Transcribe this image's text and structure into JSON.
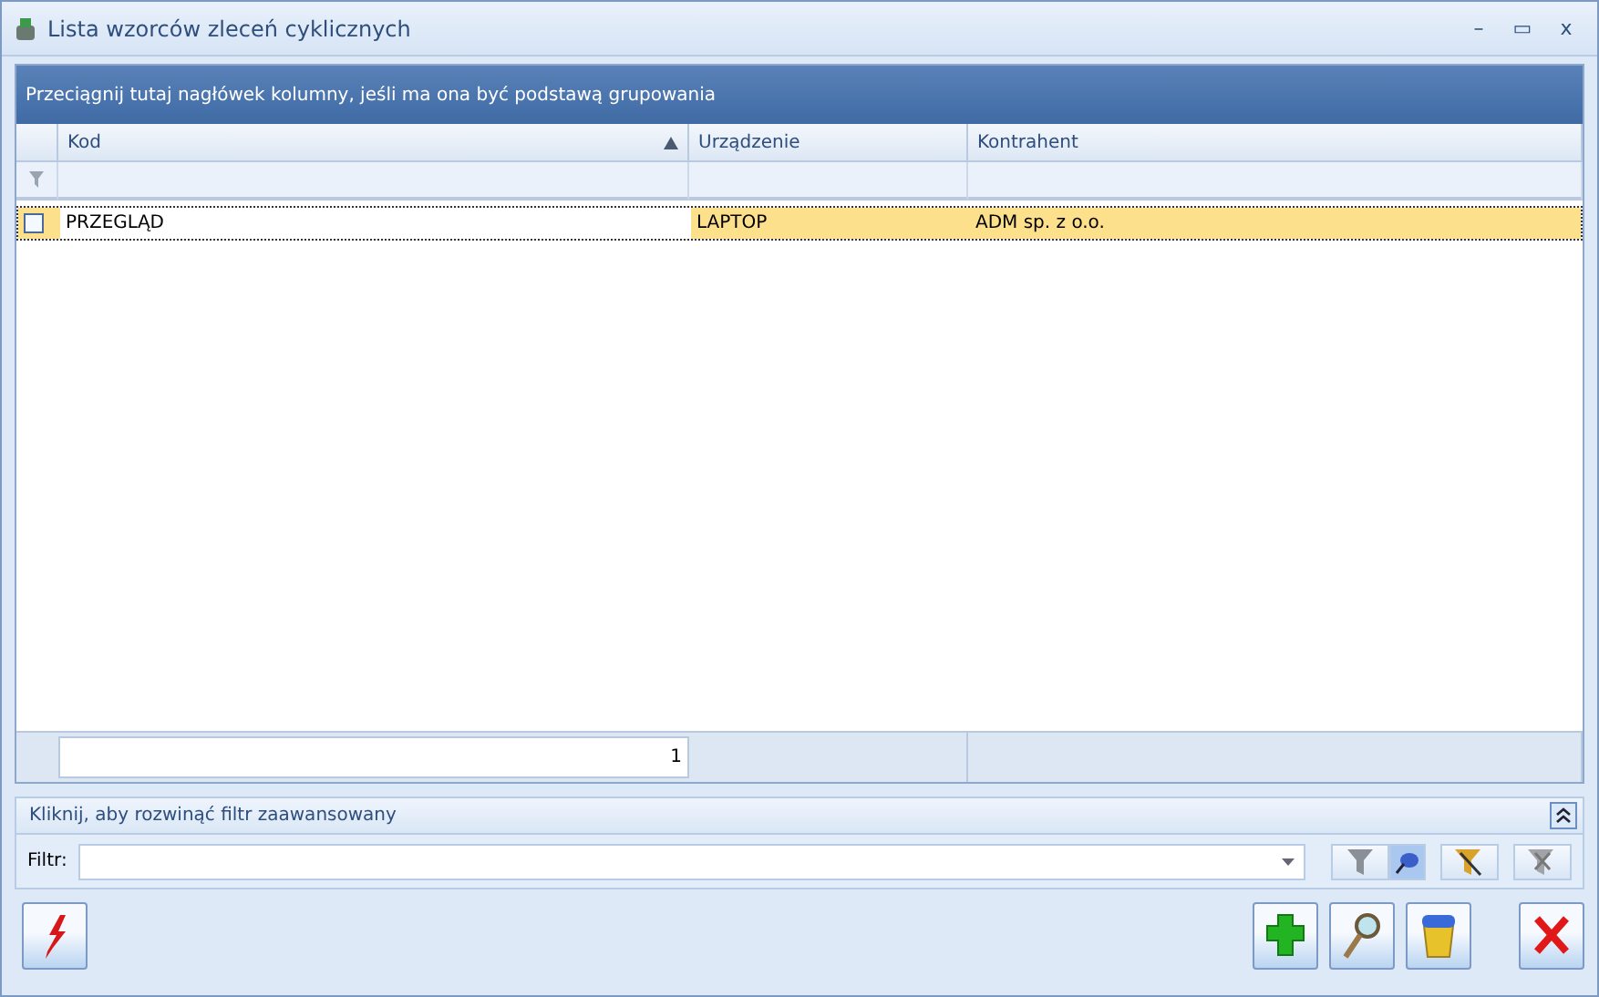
{
  "window": {
    "title": "Lista wzorców zleceń cyklicznych",
    "controls": [
      "–",
      "▭",
      "x"
    ]
  },
  "grid": {
    "group_panel": "Przeciągnij tutaj nagłówek kolumny, jeśli ma ona być podstawą grupowania",
    "columns": [
      {
        "label": "Kod",
        "sorted": true
      },
      {
        "label": "Urządzenie",
        "sorted": false
      },
      {
        "label": "Kontrahent",
        "sorted": false
      }
    ],
    "rows": [
      {
        "checked": false,
        "selected": true,
        "cells": [
          "PRZEGLĄD",
          "LAPTOP",
          "ADM sp. z o.o."
        ]
      }
    ],
    "footer": [
      "1"
    ]
  },
  "filter_panel": {
    "title": "Kliknij, aby rozwinąć filtr zaawansowany",
    "expanded": false,
    "label": "Filtr:"
  },
  "buttons": [
    {
      "kind": "bolt"
    },
    {
      "kind": "add"
    },
    {
      "kind": "search"
    },
    {
      "kind": "bin"
    },
    {
      "kind": "close"
    }
  ]
}
